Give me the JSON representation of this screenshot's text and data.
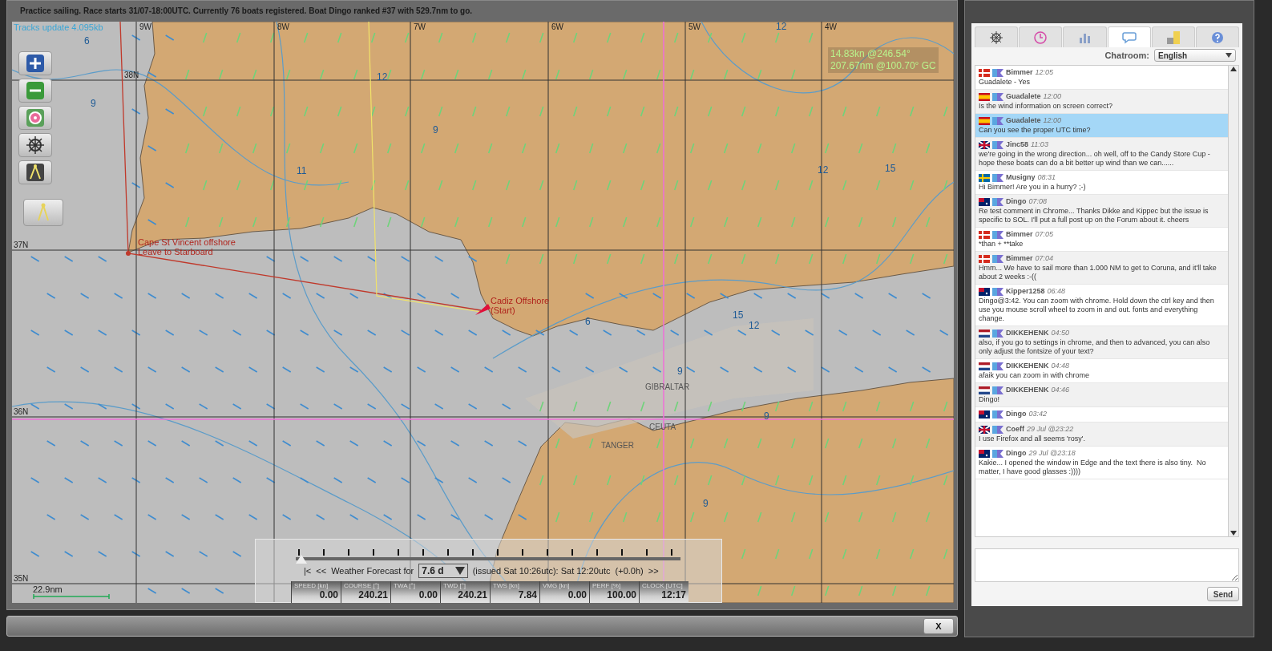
{
  "header": {
    "status": "Practice sailing. Race starts 31/07-18:00UTC. Currently 76 boats registered. Boat Dingo ranked #37 with 529.7nm to go."
  },
  "map": {
    "tracks_update": "Tracks update 4.095kb",
    "longitudes": [
      "9W",
      "8W",
      "7W",
      "6W",
      "5W",
      "4W"
    ],
    "latitudes": [
      "38N",
      "37N",
      "36N",
      "35N"
    ],
    "contour_labels": [
      "6",
      "9",
      "12",
      "11",
      "9",
      "12",
      "12",
      "15",
      "15",
      "12",
      "9",
      "6",
      "9",
      "9"
    ],
    "waypoints": [
      {
        "name": "Cape St Vincent offshore",
        "note": "Leave to Starboard"
      },
      {
        "name": "Cadiz Offshore",
        "note": "(Start)"
      }
    ],
    "places": [
      "GIBRALTAR",
      "CEUTA",
      "TANGER"
    ],
    "boat_info": [
      "14.83kn @246.54°",
      "207.67nm @100.70° GC"
    ],
    "scale": "22.9nm"
  },
  "forecast": {
    "level": 0,
    "first": "|<",
    "previous": "<<",
    "label": "Weather Forecast for",
    "value": "7.6 d",
    "issued": "(issued Sat 10:26utc): Sat 12:20utc  (+0.0h)",
    "next": ">>"
  },
  "instruments": [
    {
      "label": "SPEED [kn]",
      "value": "0.00"
    },
    {
      "label": "COURSE [°]",
      "value": "240.21"
    },
    {
      "label": "TWA [°]",
      "value": "0.00"
    },
    {
      "label": "TWD [°]",
      "value": "240.21"
    },
    {
      "label": "TWS [kn]",
      "value": "7.84"
    },
    {
      "label": "VMG [kn]",
      "value": "0.00"
    },
    {
      "label": "PERF [%]",
      "value": "100.00"
    },
    {
      "label": "CLOCK [UTC]",
      "value": "12:17"
    }
  ],
  "close_button": "X",
  "chat": {
    "tabs": [
      {
        "kind": "helm",
        "selected": false
      },
      {
        "kind": "clock",
        "selected": false
      },
      {
        "kind": "chart",
        "selected": false
      },
      {
        "kind": "chat",
        "selected": true
      },
      {
        "kind": "squares",
        "selected": false
      },
      {
        "kind": "help",
        "selected": false
      }
    ],
    "chatroom_label": "Chatroom:",
    "chatroom": "English",
    "messages": [
      {
        "user": "Bimmer",
        "time": "12:05",
        "kind": "dk",
        "text": "Guadalete - Yes",
        "selected": false
      },
      {
        "user": "Guadalete",
        "time": "12:00",
        "kind": "es",
        "text": "Is the wind information on screen correct?",
        "selected": false
      },
      {
        "user": "Guadalete",
        "time": "12:00",
        "kind": "es",
        "text": "Can you see the proper UTC time?",
        "selected": true
      },
      {
        "user": "Jinc58",
        "time": "11:03",
        "kind": "gb",
        "text": "we're going in the wrong direction... oh well, off to the Candy Store Cup - hope these boats can do a bit better up wind than we can......",
        "selected": false
      },
      {
        "user": "Musigny",
        "time": "08:31",
        "kind": "se",
        "text": "Hi Bimmer! Are you in a hurry? ;-)",
        "selected": false
      },
      {
        "user": "Dingo",
        "time": "07:08",
        "kind": "au",
        "text": "Re test comment in Chrome... Thanks Dikke and Kippec but the issue is specific to SOL. I'll put a full post up on the Forum about it. cheers",
        "selected": false
      },
      {
        "user": "Bimmer",
        "time": "07:05",
        "kind": "dk",
        "text": "*than + **take",
        "selected": false
      },
      {
        "user": "Bimmer",
        "time": "07:04",
        "kind": "dk",
        "text": "Hmm... We have to sail more than 1.000 NM to get to Coruna, and it'll take about 2 weeks :-((",
        "selected": false
      },
      {
        "user": "Kipper1258",
        "time": "06:48",
        "kind": "au",
        "text": "Dingo@3:42. You can zoom with chrome. Hold down the ctrl key and then use you mouse scroll wheel to zoom in and out. fonts and everything change.",
        "selected": false
      },
      {
        "user": "DIKKEHENK",
        "time": "04:50",
        "kind": "nl",
        "text": "also, if you go to settings in chrome, and then to advanced, you can also only adjust the fontsize of your text?",
        "selected": false
      },
      {
        "user": "DIKKEHENK",
        "time": "04:48",
        "kind": "nl",
        "text": "afaik you can zoom in with chrome",
        "selected": false
      },
      {
        "user": "DIKKEHENK",
        "time": "04:46",
        "kind": "nl",
        "text": "Dingo!",
        "selected": false
      },
      {
        "user": "Dingo",
        "time": "03:42",
        "kind": "au",
        "selected": false
      },
      {
        "user": "Coeff",
        "time": "29 Jul @23:22",
        "kind": "gb",
        "text": "I use Firefox and all seems 'rosy'.",
        "selected": false
      },
      {
        "user": "Dingo",
        "time": "29 Jul @23:18",
        "kind": "au",
        "text": "Kakie... I opened the window in Edge and the text there is also tiny.  No matter, I have good glasses :))))",
        "selected": false
      }
    ],
    "send": "Send"
  }
}
